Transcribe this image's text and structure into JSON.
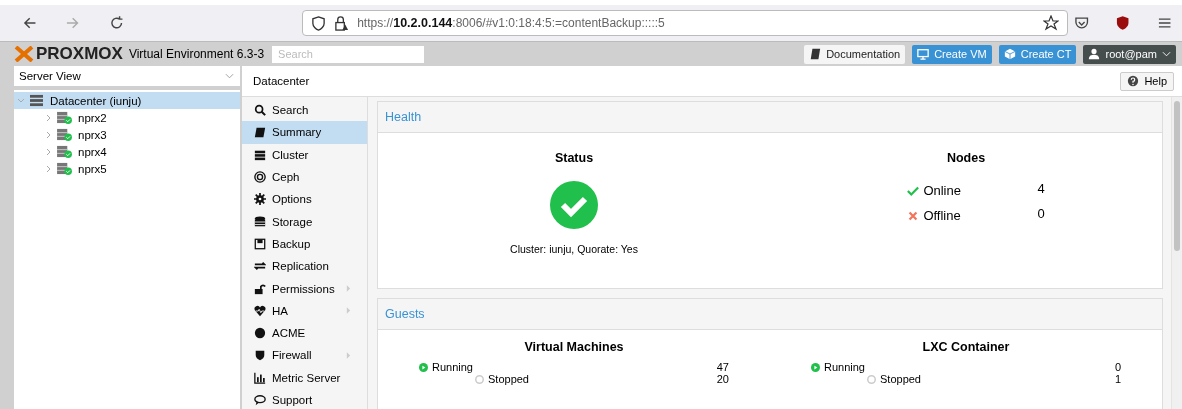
{
  "browser": {
    "url_scheme": "https://",
    "url_host": "10.2.0.144",
    "url_rest": ":8006/#v1:0:18:4:5:=contentBackup:::::5"
  },
  "header": {
    "logo": "PROXMOX",
    "product": "Virtual Environment 6.3-3",
    "search": {
      "placeholder": "Search"
    },
    "buttons": [
      {
        "label": "Documentation",
        "kind": "plain"
      },
      {
        "label": "Create VM",
        "kind": "vm"
      },
      {
        "label": "Create CT",
        "kind": "ct"
      },
      {
        "label": "root@pam",
        "kind": "user"
      }
    ]
  },
  "sidebar": {
    "view": "Server View",
    "tree": [
      {
        "label": "Datacenter (iunju)",
        "expanded": true,
        "selected": true,
        "children": [
          {
            "label": "nprx2",
            "expanded": false,
            "selected": false
          },
          {
            "label": "nprx3",
            "expanded": false,
            "selected": false
          },
          {
            "label": "nprx4",
            "expanded": false,
            "selected": false
          },
          {
            "label": "nprx5",
            "expanded": false,
            "selected": false
          }
        ]
      }
    ]
  },
  "content": {
    "title": "Datacenter",
    "help": "Help",
    "menu": [
      {
        "label": "Search",
        "selected": false,
        "expandable": false
      },
      {
        "label": "Summary",
        "selected": true,
        "expandable": false
      },
      {
        "label": "Cluster",
        "selected": false,
        "expandable": false
      },
      {
        "label": "Ceph",
        "selected": false,
        "expandable": false
      },
      {
        "label": "Options",
        "selected": false,
        "expandable": false
      },
      {
        "label": "Storage",
        "selected": false,
        "expandable": false
      },
      {
        "label": "Backup",
        "selected": false,
        "expandable": false
      },
      {
        "label": "Replication",
        "selected": false,
        "expandable": false
      },
      {
        "label": "Permissions",
        "selected": false,
        "expandable": true
      },
      {
        "label": "HA",
        "selected": false,
        "expandable": true
      },
      {
        "label": "ACME",
        "selected": false,
        "expandable": false
      },
      {
        "label": "Firewall",
        "selected": false,
        "expandable": true
      },
      {
        "label": "Metric Server",
        "selected": false,
        "expandable": false
      },
      {
        "label": "Support",
        "selected": false,
        "expandable": false
      }
    ],
    "health": {
      "title": "Health",
      "status_title": "Status",
      "status_ok": true,
      "status_text": "Cluster: iunju, Quorate: Yes",
      "nodes_title": "Nodes",
      "nodes": [
        {
          "label": "Online",
          "count": "4",
          "kind": "online"
        },
        {
          "label": "Offline",
          "count": "0",
          "kind": "offline"
        }
      ]
    },
    "guests": {
      "title": "Guests",
      "groups": [
        {
          "title": "Virtual Machines",
          "rows": [
            {
              "label": "Running",
              "count": "47",
              "kind": "running"
            },
            {
              "label": "Stopped",
              "count": "20",
              "kind": "stopped"
            }
          ]
        },
        {
          "title": "LXC Container",
          "rows": [
            {
              "label": "Running",
              "count": "0",
              "kind": "running"
            },
            {
              "label": "Stopped",
              "count": "1",
              "kind": "stopped"
            }
          ]
        }
      ]
    }
  }
}
